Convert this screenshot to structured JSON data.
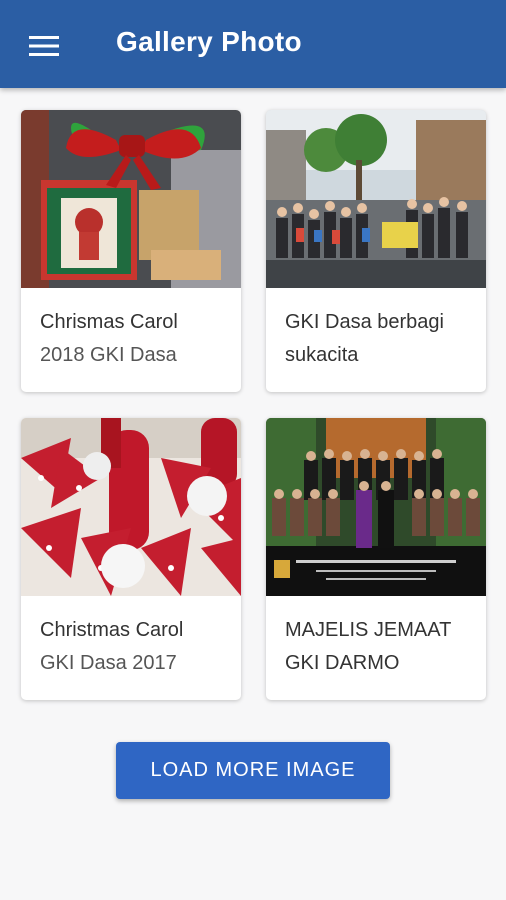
{
  "app_bar": {
    "title": "Gallery Photo",
    "menu_icon": "hamburger-menu-icon",
    "background_color": "#2b5ea4"
  },
  "gallery": {
    "items": [
      {
        "line1": "Chrismas Carol",
        "line2": "2018 GKI Dasa",
        "thumbnail": "christmas-gift-ribbon-photo"
      },
      {
        "line1": "GKI Dasa berbagi",
        "line2": "sukacita",
        "thumbnail": "outdoor-group-photo"
      },
      {
        "line1": "Christmas Carol",
        "line2": "GKI Dasa 2017",
        "thumbnail": "red-candles-ribbons-photo"
      },
      {
        "line1": "MAJELIS JEMAAT",
        "line2": "GKI DARMO",
        "thumbnail": "church-council-group-photo"
      }
    ]
  },
  "load_more": {
    "label": "LOAD MORE IMAGE",
    "color": "#2f66c4"
  }
}
